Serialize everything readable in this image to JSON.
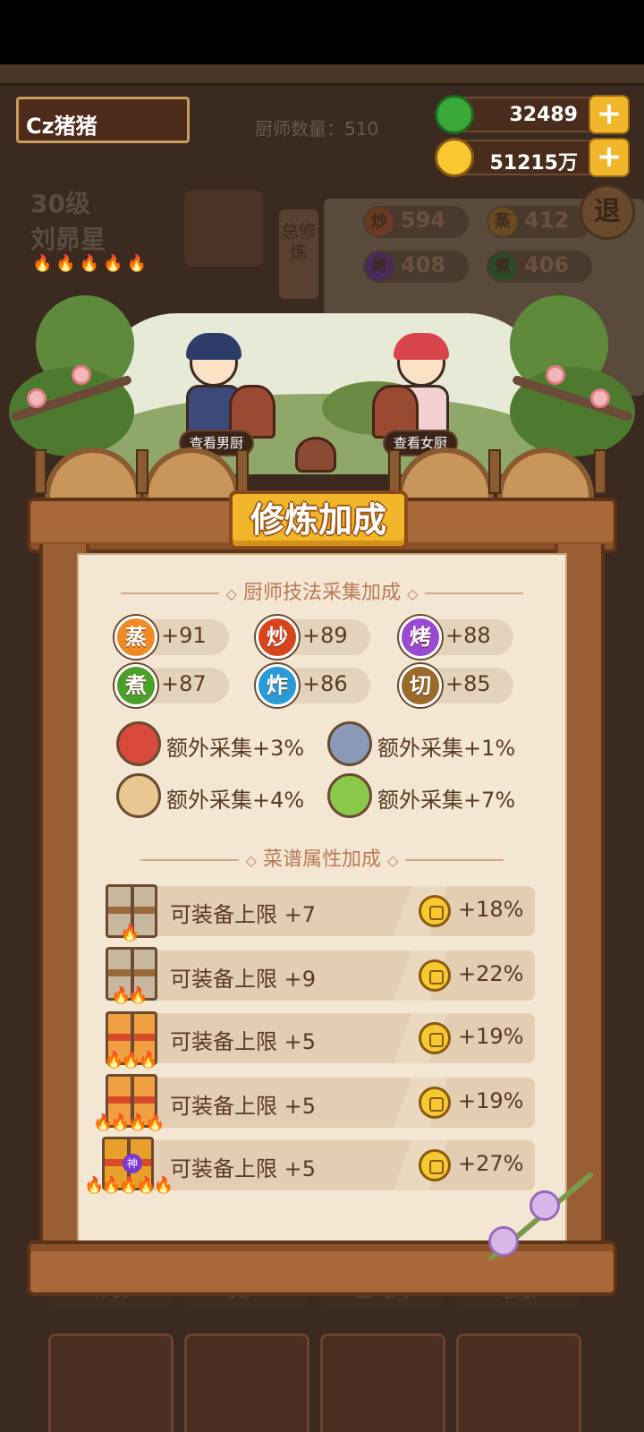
{
  "hud": {
    "player_name": "Cz猪猪",
    "chef_count": "厨师数量：510",
    "jade": "32489",
    "gold": "51215万",
    "plus": "+"
  },
  "background": {
    "level": "30级",
    "chef_name": "刘昴星",
    "side_tab": "总修炼",
    "exit": "退",
    "skills": [
      {
        "label": "炒",
        "value": "594"
      },
      {
        "label": "蒸",
        "value": "412"
      },
      {
        "label": "烤",
        "value": "408"
      },
      {
        "label": "煮",
        "value": "406"
      }
    ],
    "bottom_names": [
      "神农",
      "樊声",
      "兰飞鸿",
      "悲歌"
    ]
  },
  "scene": {
    "view_male": "查看男厨",
    "view_female": "查看女厨"
  },
  "modal": {
    "title": "修炼加成",
    "section1_title": "厨师技法采集加成",
    "skills": [
      {
        "label": "蒸",
        "value": "+91",
        "color": "#f08a24"
      },
      {
        "label": "炒",
        "value": "+89",
        "color": "#d8441c"
      },
      {
        "label": "烤",
        "value": "+88",
        "color": "#9a4ad0"
      },
      {
        "label": "煮",
        "value": "+87",
        "color": "#4aa02a"
      },
      {
        "label": "炸",
        "value": "+86",
        "color": "#2a9ad8"
      },
      {
        "label": "切",
        "value": "+85",
        "color": "#9a6a2a"
      }
    ],
    "extras": [
      {
        "icon": "meat-icon",
        "label": "额外采集+3%"
      },
      {
        "icon": "fish-icon",
        "label": "额外采集+1%"
      },
      {
        "icon": "flour-icon",
        "label": "额外采集+4%"
      },
      {
        "icon": "vegetable-icon",
        "label": "额外采集+7%"
      }
    ],
    "section2_title": "菜谱属性加成",
    "recipes": [
      {
        "label": "可装备上限 +7",
        "bonus": "+18%",
        "flames": "🔥",
        "tier": "1"
      },
      {
        "label": "可装备上限 +9",
        "bonus": "+22%",
        "flames": "🔥🔥",
        "tier": "2"
      },
      {
        "label": "可装备上限 +5",
        "bonus": "+19%",
        "flames": "🔥🔥🔥",
        "tier": "3"
      },
      {
        "label": "可装备上限 +5",
        "bonus": "+19%",
        "flames": "🔥🔥🔥🔥",
        "tier": "4"
      },
      {
        "label": "可装备上限 +5",
        "bonus": "+27%",
        "flames": "🔥🔥🔥🔥🔥",
        "tier": "5",
        "badge": "神"
      }
    ]
  },
  "colors": {
    "gold": "#f1b62a",
    "wood": "#a8683a",
    "paper": "#f3e7d4"
  }
}
